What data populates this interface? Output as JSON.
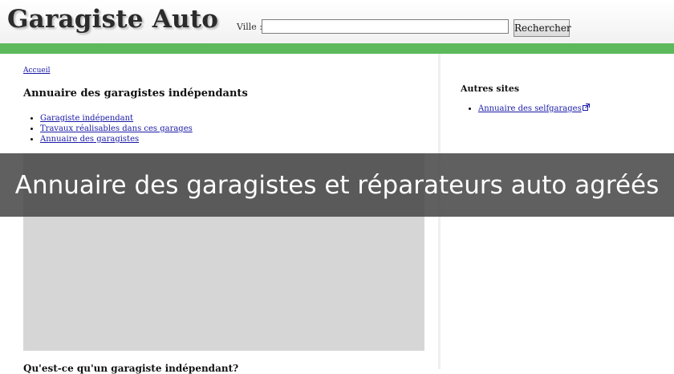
{
  "header": {
    "logo": "Garagiste Auto",
    "search_label": "Ville :",
    "search_value": "",
    "search_button": "Rechercher"
  },
  "main": {
    "breadcrumb": "Accueil",
    "heading": "Annuaire des garagistes indépendants",
    "links": [
      "Garagiste indépendant",
      "Travaux réalisables dans ces garages",
      "Annuaire des garagistes"
    ],
    "subheading": "Qu'est-ce qu'un garagiste indépendant?"
  },
  "sidebar": {
    "heading": "Autres sites",
    "links": [
      "Annuaire des selfgarages"
    ],
    "external_icon": "external-link-icon"
  },
  "overlay": {
    "caption": "Annuaire des garagistes et réparateurs auto agréés"
  },
  "colors": {
    "green_bar": "#5cb95c",
    "link": "#1a1aa8",
    "overlay": "#464646"
  }
}
